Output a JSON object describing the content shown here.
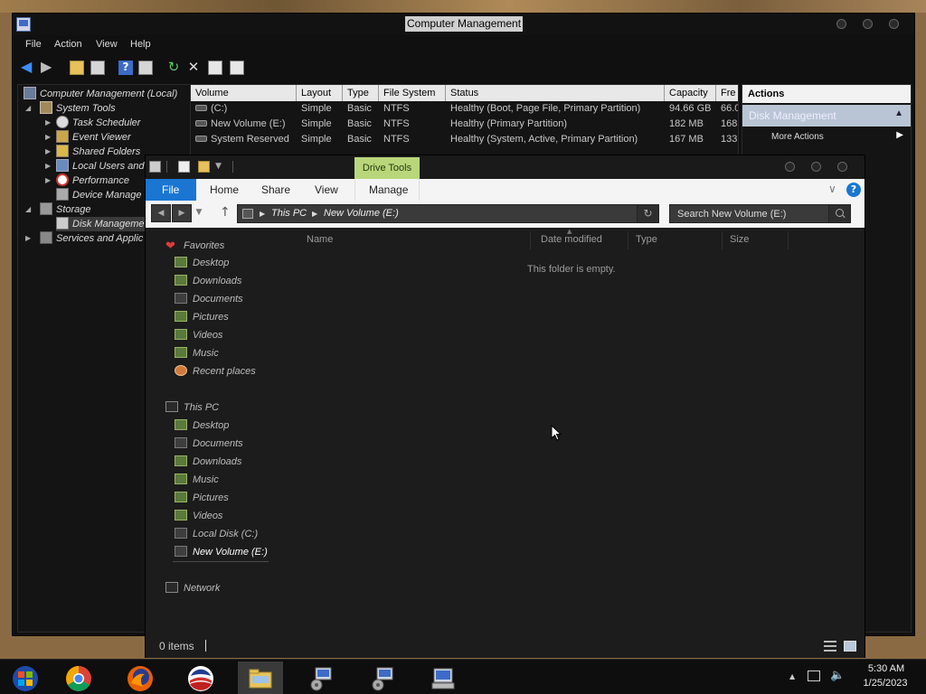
{
  "computer_management": {
    "title": "Computer Management",
    "menu": [
      "File",
      "Action",
      "View",
      "Help"
    ],
    "tree": {
      "root": "Computer Management (Local)",
      "system_tools": "System Tools",
      "task_scheduler": "Task Scheduler",
      "event_viewer": "Event Viewer",
      "shared_folders": "Shared Folders",
      "local_users": "Local Users and",
      "performance": "Performance",
      "device_manager": "Device Manage",
      "storage": "Storage",
      "disk_management": "Disk Manageme",
      "services": "Services and Applic"
    },
    "columns": [
      "Volume",
      "Layout",
      "Type",
      "File System",
      "Status",
      "Capacity",
      "Fre"
    ],
    "rows": [
      {
        "volume": "(C:)",
        "layout": "Simple",
        "type": "Basic",
        "fs": "NTFS",
        "status": "Healthy (Boot, Page File, Primary Partition)",
        "capacity": "94.66 GB",
        "free": "66.0"
      },
      {
        "volume": "New Volume (E:)",
        "layout": "Simple",
        "type": "Basic",
        "fs": "NTFS",
        "status": "Healthy (Primary Partition)",
        "capacity": "182 MB",
        "free": "168"
      },
      {
        "volume": "System Reserved",
        "layout": "Simple",
        "type": "Basic",
        "fs": "NTFS",
        "status": "Healthy (System, Active, Primary Partition)",
        "capacity": "167 MB",
        "free": "133"
      }
    ],
    "actions": {
      "header": "Actions",
      "section": "Disk Management",
      "more": "More Actions"
    }
  },
  "explorer": {
    "context_tab": "Drive Tools",
    "ribbon": {
      "file": "File",
      "home": "Home",
      "share": "Share",
      "view": "View",
      "manage": "Manage",
      "help": "?"
    },
    "address": {
      "root": "This PC",
      "current": "New Volume (E:)"
    },
    "search_placeholder": "Search New Volume (E:)",
    "nav": {
      "favorites": "Favorites",
      "fav_items": [
        "Desktop",
        "Downloads",
        "Documents",
        "Pictures",
        "Videos",
        "Music",
        "Recent places"
      ],
      "this_pc": "This PC",
      "pc_items": [
        "Desktop",
        "Documents",
        "Downloads",
        "Music",
        "Pictures",
        "Videos",
        "Local Disk (C:)",
        "New Volume (E:)"
      ],
      "network": "Network"
    },
    "columns": [
      "Name",
      "Date modified",
      "Type",
      "Size"
    ],
    "empty_message": "This folder is empty.",
    "status": "0 items"
  },
  "taskbar": {
    "time": "5:30 AM",
    "date": "1/25/2023"
  },
  "colors": {
    "accent_blue": "#1a76d2",
    "drive_tools_green": "#b9d77a",
    "window_dark": "#1c1c1c"
  }
}
